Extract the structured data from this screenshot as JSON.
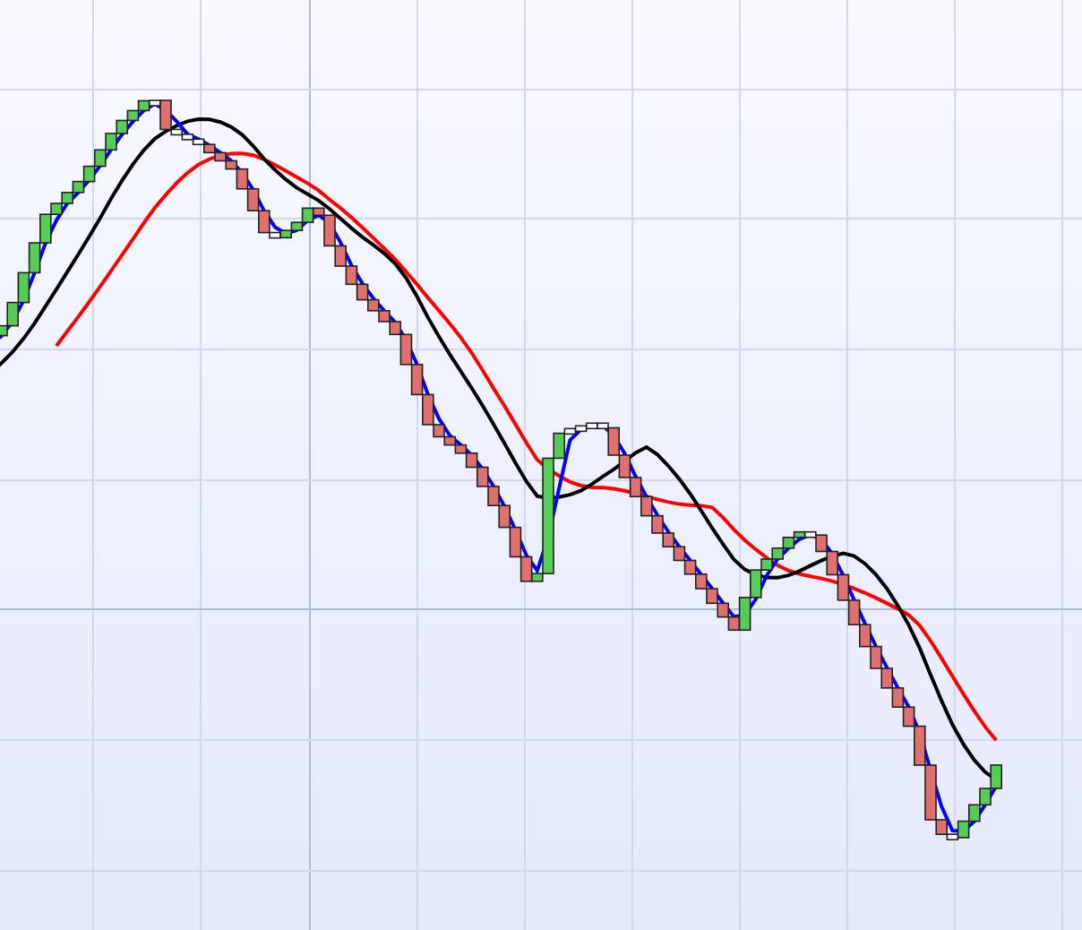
{
  "chart": {
    "lines": [
      {
        "kind": "slow",
        "color": "#ff0000"
      },
      {
        "kind": "medium",
        "color": "#000000"
      },
      {
        "kind": "fast",
        "color": "#0000ff"
      }
    ]
  }
}
